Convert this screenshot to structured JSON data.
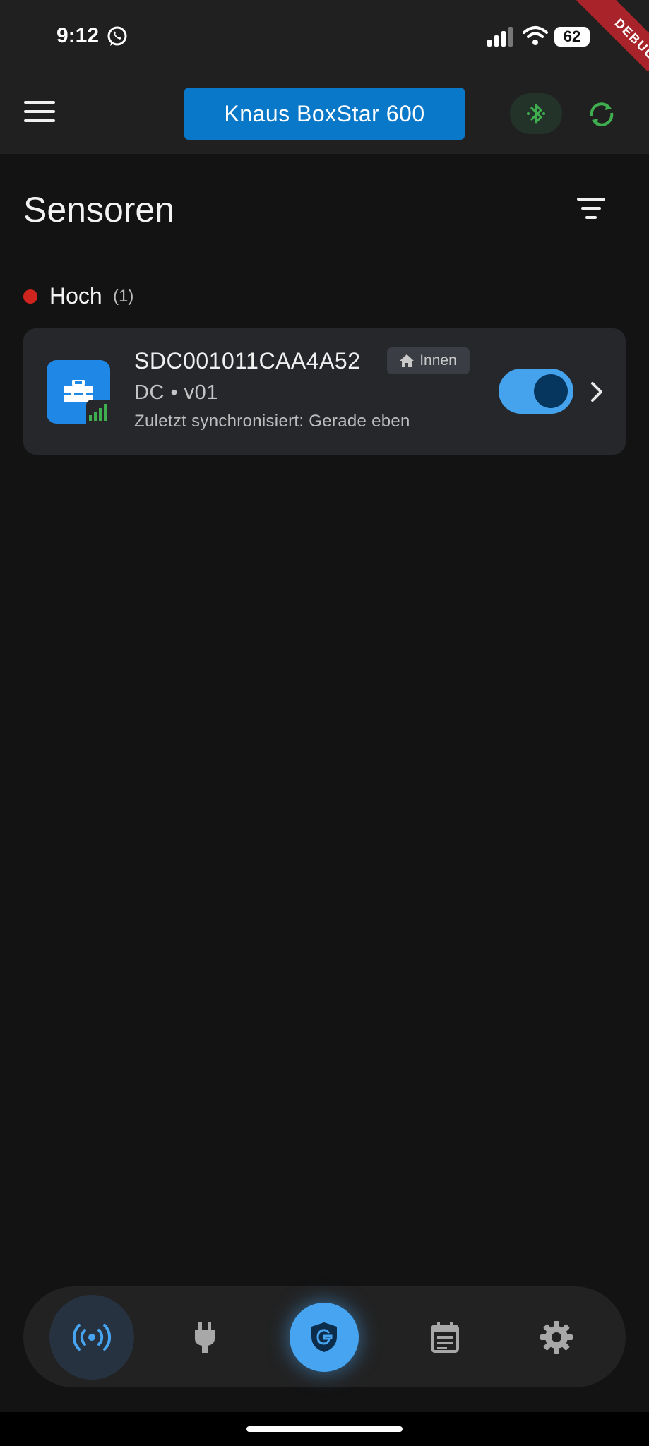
{
  "status_bar": {
    "time": "9:12",
    "battery": "62",
    "debug_label": "DEBUG"
  },
  "app_bar": {
    "title": "Knaus BoxStar 600"
  },
  "page": {
    "title": "Sensoren"
  },
  "group": {
    "label": "Hoch",
    "count": "(1)",
    "color": "#d0241e"
  },
  "device": {
    "name": "SDC001011CAA4A52",
    "location": "Innen",
    "meta": "DC • v01",
    "sync": "Zuletzt synchronisiert: Gerade eben",
    "enabled": true
  },
  "colors": {
    "accent": "#46a4f0",
    "bluetooth": "#3fae4f",
    "title_button": "#0a78c8"
  },
  "nav": [
    "sensors-icon",
    "power-plug-icon",
    "shield-icon",
    "log-icon",
    "gear-icon"
  ]
}
